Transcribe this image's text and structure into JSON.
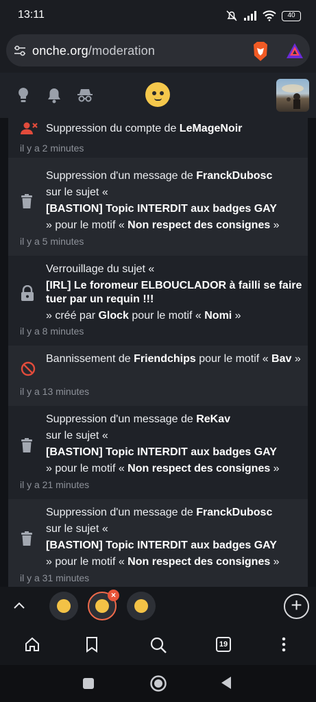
{
  "statusbar": {
    "time": "13:11",
    "battery": "40"
  },
  "browser": {
    "domain": "onche.org",
    "path": "/moderation"
  },
  "site": {
    "icons": [
      "lightbulb-icon",
      "bell-icon",
      "incognito-icon"
    ]
  },
  "entries": [
    {
      "icon": "user-remove-icon",
      "parts": [
        "Suppression du compte de ",
        "LeMageNoir"
      ],
      "time": "il y a 2 minutes"
    },
    {
      "icon": "trash-icon",
      "lines": [
        [
          "Suppression d'un message de ",
          "FranckDubosc"
        ],
        [
          "sur le sujet «",
          ""
        ],
        [
          "",
          "[BASTION] Topic INTERDIT aux badges GAY"
        ],
        [
          "» pour le motif « ",
          "Non respect des consignes",
          " »"
        ]
      ],
      "time": "il y a 5 minutes"
    },
    {
      "icon": "lock-icon",
      "lines": [
        [
          "Verrouillage du sujet «",
          ""
        ],
        [
          "",
          "[IRL] Le foromeur ELBOUCLADOR à failli se faire tuer par un requin !!!"
        ],
        [
          "» créé par ",
          "Glock",
          " pour le motif « ",
          "Nomi",
          " »"
        ]
      ],
      "time": "il y a 8 minutes"
    },
    {
      "icon": "ban-icon",
      "lines": [
        [
          "Bannissement de ",
          "Friendchips",
          " pour le motif « ",
          "Bav",
          " »"
        ]
      ],
      "time": "il y a 13 minutes"
    },
    {
      "icon": "trash-icon",
      "lines": [
        [
          "Suppression d'un message de ",
          "ReKav"
        ],
        [
          "sur le sujet «",
          ""
        ],
        [
          "",
          "[BASTION] Topic INTERDIT aux badges GAY"
        ],
        [
          "» pour le motif « ",
          "Non respect des consignes",
          " »"
        ]
      ],
      "time": "il y a 21 minutes"
    },
    {
      "icon": "trash-icon",
      "lines": [
        [
          "Suppression d'un message de ",
          "FranckDubosc"
        ],
        [
          "sur le sujet «",
          ""
        ],
        [
          "",
          "[BASTION] Topic INTERDIT aux badges GAY"
        ],
        [
          "» pour le motif « ",
          "Non respect des consignes",
          " »"
        ]
      ],
      "time": "il y a 31 minutes"
    }
  ],
  "tabs": {
    "count": "19",
    "new_tab_label": "+"
  },
  "colors": {
    "accent_red": "#e24b3b",
    "background": "#111317",
    "entry_dark": "#1f2228",
    "entry_light": "#26292f"
  }
}
